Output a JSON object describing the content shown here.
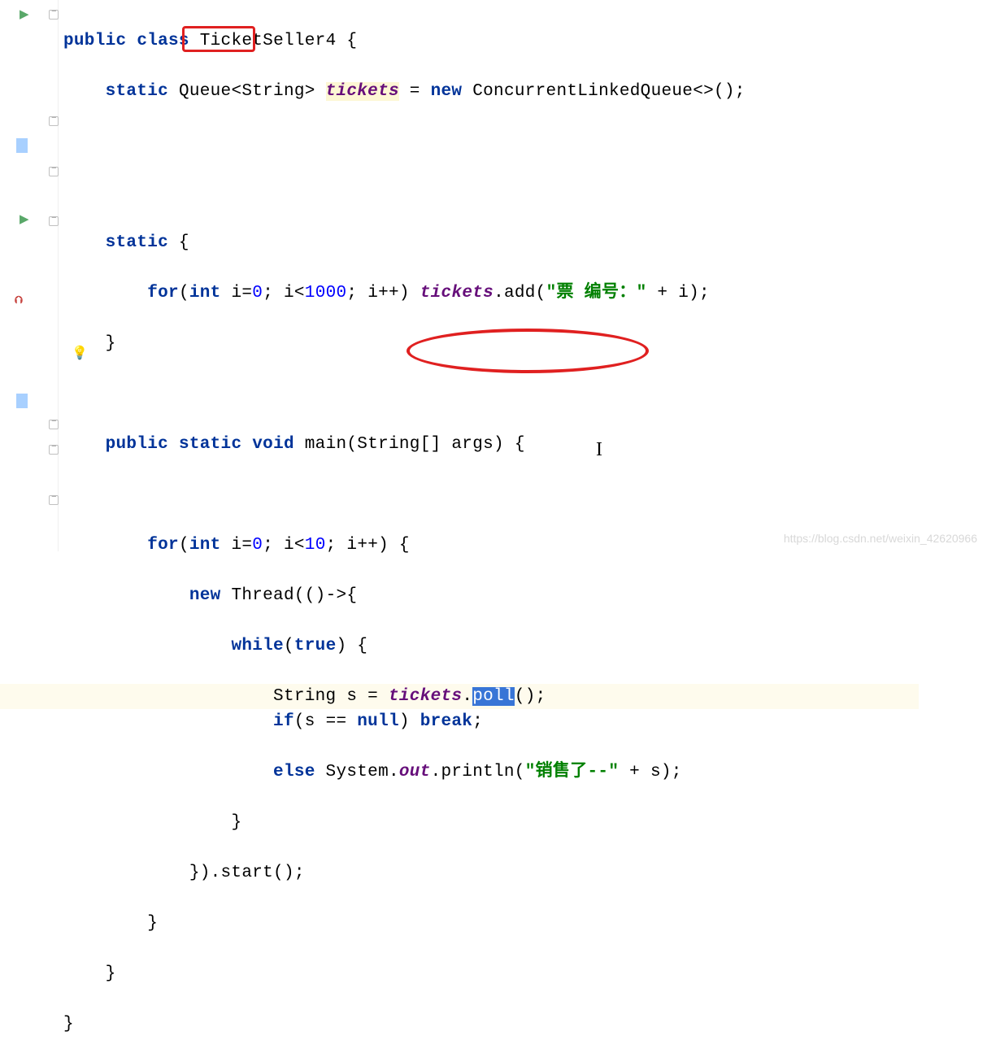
{
  "gutter": {
    "run1": "▶",
    "run2": "▶",
    "red_arrow": "⮉",
    "bulb": "💡"
  },
  "code": {
    "line1": {
      "public": "public",
      "class": "class",
      "className": "TicketSeller4",
      "brace": " {"
    },
    "line2": {
      "static": "static",
      "queue": "Queue",
      "generic": "<String>",
      "tickets": "tickets",
      "eq": " = ",
      "new": "new",
      "clq": " ConcurrentLinkedQueue<>();"
    },
    "line3": {
      "static": "static",
      "brace": " {"
    },
    "line4": {
      "for": "for",
      "int": "int",
      "init": " i=",
      "zero": "0",
      "semi1": "; i<",
      "limit": "1000",
      "semi2": "; i++) ",
      "tickets": "tickets",
      "add": ".add(",
      "str": "\"票 编号：\"",
      "plus": " + i);"
    },
    "line5": "}",
    "line6": {
      "public": "public",
      "static": "static",
      "void": "void",
      "main": " main(String[] args) {"
    },
    "line7": {
      "for": "for",
      "int": "int",
      "init": " i=",
      "zero": "0",
      "semi1": "; i<",
      "limit": "10",
      "semi2": "; i++) {"
    },
    "line8": {
      "new": "new",
      "thread": " Thread(()->{",
      "rest": ""
    },
    "line9": {
      "while": "while",
      "true": "true",
      "rest": ") {"
    },
    "line10": {
      "str": "String s = ",
      "tickets": "tickets",
      "dot": ".",
      "poll": "poll",
      "end": "();"
    },
    "line11": {
      "if": "if",
      "cond": "(s == ",
      "null": "null",
      "close": ") ",
      "break": "break",
      "semi": ";"
    },
    "line12": {
      "else": "else",
      "sys": " System.",
      "out": "out",
      "print": ".println(",
      "str": "\"销售了--\"",
      "plus": " + s);"
    },
    "line13": "}",
    "line14": "}).start();",
    "line15": "}",
    "line16": "}",
    "line17": "}"
  },
  "watermark": "https://blog.csdn.net/weixin_42620966"
}
